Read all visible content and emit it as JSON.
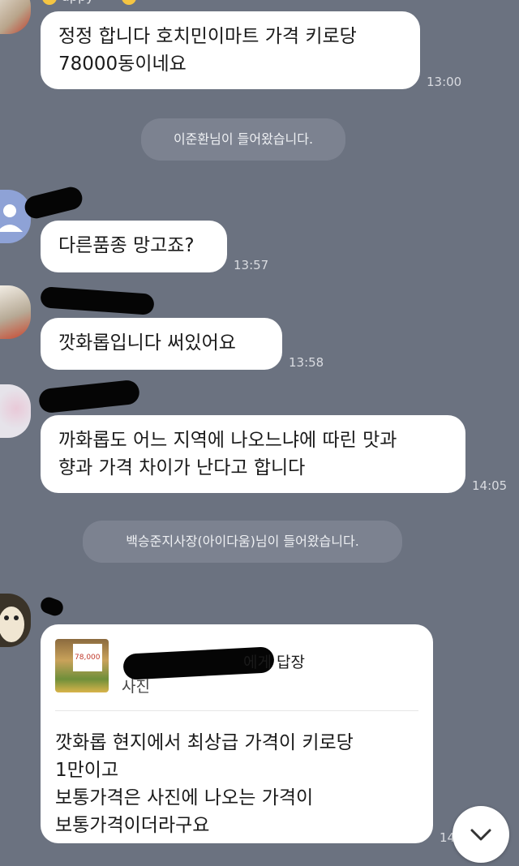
{
  "header": {
    "partial_name": "appy"
  },
  "messages": [
    {
      "id": "m1",
      "lines": [
        "정정 합니다 호치민이마트 가격 키로당",
        "78000동이네요"
      ],
      "time": "13:00"
    },
    {
      "id": "m2",
      "lines": [
        "다른품종 망고죠?"
      ],
      "time": "13:57"
    },
    {
      "id": "m3",
      "lines": [
        "깟화롭입니다 써있어요"
      ],
      "time": "13:58"
    },
    {
      "id": "m4",
      "lines": [
        "까화롭도 어느 지역에 나오느냐에 따린 맛과",
        "향과 가격 차이가 난다고 합니다"
      ],
      "time": "14:05"
    },
    {
      "id": "m5",
      "reply": {
        "to_suffix": "에게 답장",
        "quoted": "사진",
        "thumb_price": "78,000"
      },
      "lines": [
        "깟화롭 현지에서 최상급 가격이 키로당",
        "1만이고",
        "보통가격은 사진에 나오는 가격이",
        "보통가격이더라구요"
      ],
      "time": "14"
    }
  ],
  "system_messages": [
    {
      "text": "이준환님이 들어왔습니다."
    },
    {
      "text": "백승준지사장(아이다움)님이 들어왔습니다."
    }
  ],
  "scroll_button": {
    "icon": "chevron-down-icon"
  },
  "colors": {
    "background": "#6b7280",
    "bubble": "#ffffff",
    "system_pill": "#7c8290"
  }
}
